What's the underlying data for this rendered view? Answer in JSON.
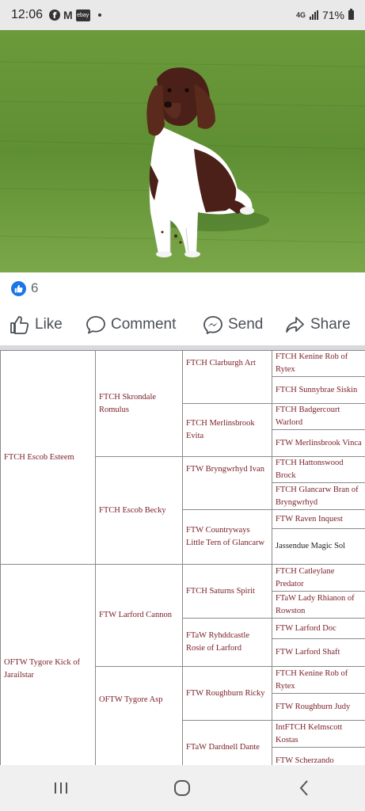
{
  "status_bar": {
    "time": "12:06",
    "network": "4G",
    "battery": "71%",
    "icons": [
      "facebook-icon",
      "gmail-icon",
      "ebay-icon",
      "notification-dot-icon",
      "signal-icon",
      "battery-icon"
    ]
  },
  "post": {
    "image": "brown-and-white-spaniel-sitting-on-grass",
    "reactions": {
      "count": "6",
      "icon": "like-icon",
      "color": "#1b74e4"
    },
    "actions": [
      {
        "label": "Like",
        "icon": "thumbs-up-icon"
      },
      {
        "label": "Comment",
        "icon": "comment-icon"
      },
      {
        "label": "Send",
        "icon": "messenger-icon"
      },
      {
        "label": "Share",
        "icon": "share-icon"
      }
    ]
  },
  "pedigree": {
    "text_color": "#7b2027",
    "sire": {
      "name": "FTCH Escob Esteem",
      "sire": {
        "name": "FTCH Skrondale Romulus",
        "sire": {
          "name": "FTCH Clarburgh Art",
          "sire": "FTCH Kenine Rob of Rytex",
          "dam": "FTCH Sunnybrae Siskin"
        },
        "dam": {
          "name": "FTCH Merlinsbrook Evita",
          "sire": "FTCH Badgercourt Warlord",
          "dam": "FTW Merlinsbrook Vinca"
        }
      },
      "dam": {
        "name": "FTCH Escob Becky",
        "sire": {
          "name": "FTW Bryngwrhyd Ivan",
          "sire": "FTCH Hattonswood Brock",
          "dam": "FTCH Glancarw Bran of Bryngwrhyd"
        },
        "dam": {
          "name": "FTW Countryways Little Tern of Glancarw",
          "sire": "FTW Raven Inquest",
          "dam": "Jassendue Magic Sol"
        }
      }
    },
    "dam": {
      "name": "OFTW Tygore Kick of Jarailstar",
      "sire": {
        "name": "FTW Larford Cannon",
        "sire": {
          "name": "FTCH Saturns Spirit",
          "sire": "FTCH Catleylane Predator",
          "dam": "FTaW Lady Rhianon of Rowston"
        },
        "dam": {
          "name": "FTaW Ryhddcastle Rosie of Larford",
          "sire": "FTW Larford Doc",
          "dam": "FTW Larford Shaft"
        }
      },
      "dam": {
        "name": "OFTW Tygore Asp",
        "sire": {
          "name": "FTW Roughburn Ricky",
          "sire": "FTCH Kenine Rob of Rytex",
          "dam": "FTW Roughburn Judy"
        },
        "dam": {
          "name": "FTaW Dardnell Dante",
          "sire": "IntFTCH Kelmscott Kostas",
          "dam": "FTW Scherzando"
        }
      }
    }
  },
  "nav_bar": {
    "buttons": [
      {
        "name": "recent-apps",
        "icon": "recent-apps-icon"
      },
      {
        "name": "home",
        "icon": "home-icon"
      },
      {
        "name": "back",
        "icon": "back-icon"
      }
    ]
  }
}
